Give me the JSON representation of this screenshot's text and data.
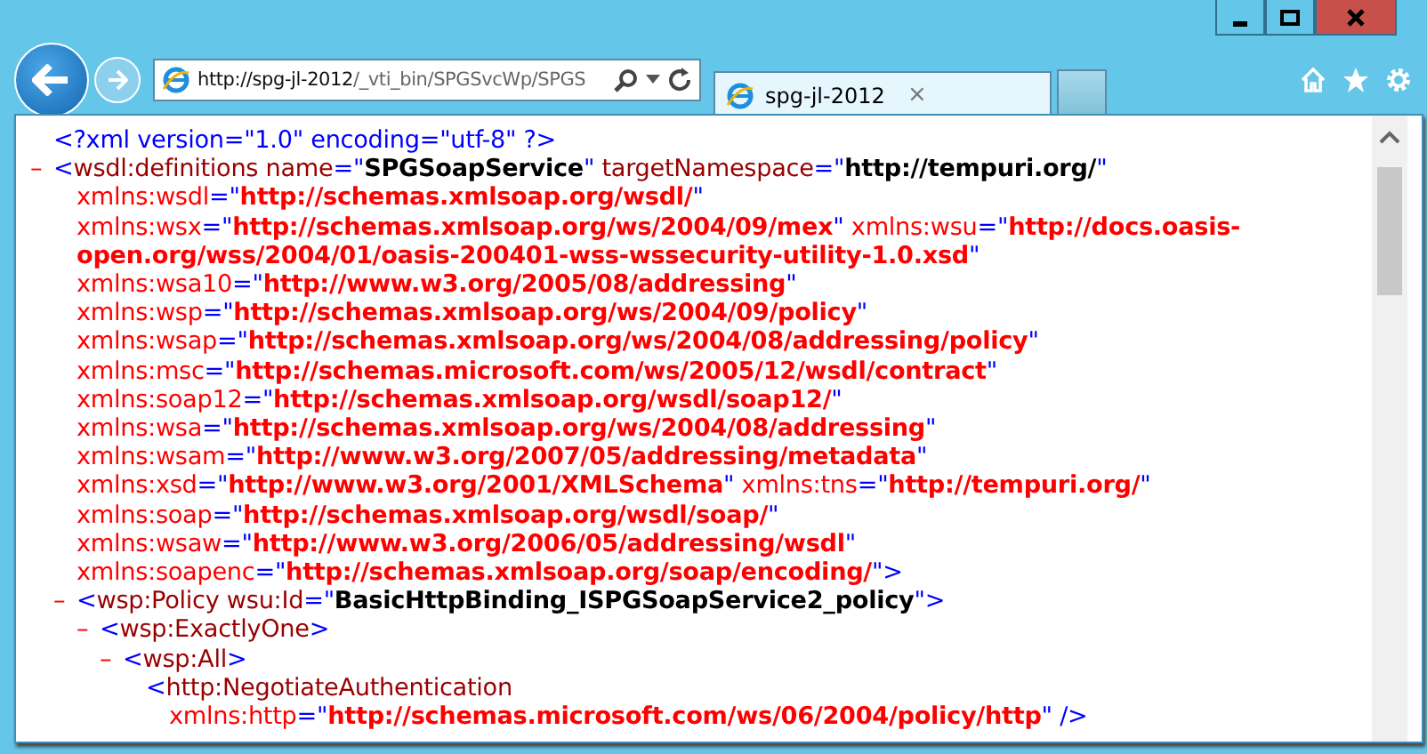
{
  "browser": {
    "address": {
      "url_host": "http://spg-jl-2012",
      "url_path": "/_vti_bin/SPGSvcWp/SPGS"
    },
    "tabs": [
      {
        "title": "spg-jl-2012",
        "selected": true,
        "close": "×"
      }
    ]
  },
  "document": {
    "declaration": [
      {
        "kind": "punct",
        "text": "<?xml version=\"1.0\" encoding=\"utf-8\" ?>"
      }
    ],
    "nodes": [
      {
        "toggle": "–",
        "expanded": true,
        "lines": [
          [
            {
              "kind": "punct",
              "text": "<"
            },
            {
              "kind": "name",
              "text": "wsdl:definitions name"
            },
            {
              "kind": "punct",
              "text": "=\""
            },
            {
              "kind": "value",
              "text": "SPGSoapService"
            },
            {
              "kind": "punct",
              "text": "\""
            },
            {
              "kind": "name",
              "text": " targetNamespace"
            },
            {
              "kind": "punct",
              "text": "=\""
            },
            {
              "kind": "value",
              "text": "http://tempuri.org/"
            },
            {
              "kind": "punct",
              "text": "\""
            }
          ],
          [
            {
              "kind": "nsattr",
              "text": "xmlns:wsdl"
            },
            {
              "kind": "punct",
              "text": "=\""
            },
            {
              "kind": "nsvalue",
              "text": "http://schemas.xmlsoap.org/wsdl/"
            },
            {
              "kind": "punct",
              "text": "\""
            }
          ],
          [
            {
              "kind": "nsattr",
              "text": "xmlns:wsx"
            },
            {
              "kind": "punct",
              "text": "=\""
            },
            {
              "kind": "nsvalue",
              "text": "http://schemas.xmlsoap.org/ws/2004/09/mex"
            },
            {
              "kind": "punct",
              "text": "\""
            },
            {
              "kind": "nsattr",
              "text": " xmlns:wsu"
            },
            {
              "kind": "punct",
              "text": "=\""
            },
            {
              "kind": "nsvalue",
              "text": "http://docs.oasis-"
            }
          ],
          [
            {
              "kind": "nsvalue",
              "text": "open.org/wss/2004/01/oasis-200401-wss-wssecurity-utility-1.0.xsd"
            },
            {
              "kind": "punct",
              "text": "\""
            }
          ],
          [
            {
              "kind": "nsattr",
              "text": "xmlns:wsa10"
            },
            {
              "kind": "punct",
              "text": "=\""
            },
            {
              "kind": "nsvalue",
              "text": "http://www.w3.org/2005/08/addressing"
            },
            {
              "kind": "punct",
              "text": "\""
            }
          ],
          [
            {
              "kind": "nsattr",
              "text": "xmlns:wsp"
            },
            {
              "kind": "punct",
              "text": "=\""
            },
            {
              "kind": "nsvalue",
              "text": "http://schemas.xmlsoap.org/ws/2004/09/policy"
            },
            {
              "kind": "punct",
              "text": "\""
            }
          ],
          [
            {
              "kind": "nsattr",
              "text": "xmlns:wsap"
            },
            {
              "kind": "punct",
              "text": "=\""
            },
            {
              "kind": "nsvalue",
              "text": "http://schemas.xmlsoap.org/ws/2004/08/addressing/policy"
            },
            {
              "kind": "punct",
              "text": "\""
            }
          ],
          [
            {
              "kind": "nsattr",
              "text": "xmlns:msc"
            },
            {
              "kind": "punct",
              "text": "=\""
            },
            {
              "kind": "nsvalue",
              "text": "http://schemas.microsoft.com/ws/2005/12/wsdl/contract"
            },
            {
              "kind": "punct",
              "text": "\""
            }
          ],
          [
            {
              "kind": "nsattr",
              "text": "xmlns:soap12"
            },
            {
              "kind": "punct",
              "text": "=\""
            },
            {
              "kind": "nsvalue",
              "text": "http://schemas.xmlsoap.org/wsdl/soap12/"
            },
            {
              "kind": "punct",
              "text": "\""
            }
          ],
          [
            {
              "kind": "nsattr",
              "text": "xmlns:wsa"
            },
            {
              "kind": "punct",
              "text": "=\""
            },
            {
              "kind": "nsvalue",
              "text": "http://schemas.xmlsoap.org/ws/2004/08/addressing"
            },
            {
              "kind": "punct",
              "text": "\""
            }
          ],
          [
            {
              "kind": "nsattr",
              "text": "xmlns:wsam"
            },
            {
              "kind": "punct",
              "text": "=\""
            },
            {
              "kind": "nsvalue",
              "text": "http://www.w3.org/2007/05/addressing/metadata"
            },
            {
              "kind": "punct",
              "text": "\""
            }
          ],
          [
            {
              "kind": "nsattr",
              "text": "xmlns:xsd"
            },
            {
              "kind": "punct",
              "text": "=\""
            },
            {
              "kind": "nsvalue",
              "text": "http://www.w3.org/2001/XMLSchema"
            },
            {
              "kind": "punct",
              "text": "\""
            },
            {
              "kind": "nsattr",
              "text": " xmlns:tns"
            },
            {
              "kind": "punct",
              "text": "=\""
            },
            {
              "kind": "nsvalue",
              "text": "http://tempuri.org/"
            },
            {
              "kind": "punct",
              "text": "\""
            }
          ],
          [
            {
              "kind": "nsattr",
              "text": "xmlns:soap"
            },
            {
              "kind": "punct",
              "text": "=\""
            },
            {
              "kind": "nsvalue",
              "text": "http://schemas.xmlsoap.org/wsdl/soap/"
            },
            {
              "kind": "punct",
              "text": "\""
            }
          ],
          [
            {
              "kind": "nsattr",
              "text": "xmlns:wsaw"
            },
            {
              "kind": "punct",
              "text": "=\""
            },
            {
              "kind": "nsvalue",
              "text": "http://www.w3.org/2006/05/addressing/wsdl"
            },
            {
              "kind": "punct",
              "text": "\""
            }
          ],
          [
            {
              "kind": "nsattr",
              "text": "xmlns:soapenc"
            },
            {
              "kind": "punct",
              "text": "=\""
            },
            {
              "kind": "nsvalue",
              "text": "http://schemas.xmlsoap.org/soap/encoding/"
            },
            {
              "kind": "punct",
              "text": "\">"
            }
          ]
        ],
        "children": [
          {
            "toggle": "–",
            "expanded": true,
            "lines": [
              [
                {
                  "kind": "punct",
                  "text": "<"
                },
                {
                  "kind": "name",
                  "text": "wsp:Policy wsu:Id"
                },
                {
                  "kind": "punct",
                  "text": "=\""
                },
                {
                  "kind": "value",
                  "text": "BasicHttpBinding_ISPGSoapService2_policy"
                },
                {
                  "kind": "punct",
                  "text": "\">"
                }
              ]
            ],
            "children": [
              {
                "toggle": "–",
                "expanded": true,
                "lines": [
                  [
                    {
                      "kind": "punct",
                      "text": "<"
                    },
                    {
                      "kind": "name",
                      "text": "wsp:ExactlyOne"
                    },
                    {
                      "kind": "punct",
                      "text": ">"
                    }
                  ]
                ],
                "children": [
                  {
                    "toggle": "–",
                    "expanded": true,
                    "lines": [
                      [
                        {
                          "kind": "punct",
                          "text": "<"
                        },
                        {
                          "kind": "name",
                          "text": "wsp:All"
                        },
                        {
                          "kind": "punct",
                          "text": ">"
                        }
                      ]
                    ],
                    "children": [
                      {
                        "lines": [
                          [
                            {
                              "kind": "punct",
                              "text": "<"
                            },
                            {
                              "kind": "name",
                              "text": "http:NegotiateAuthentication"
                            }
                          ],
                          [
                            {
                              "kind": "nsattr",
                              "text": "xmlns:http"
                            },
                            {
                              "kind": "punct",
                              "text": "=\""
                            },
                            {
                              "kind": "nsvalue",
                              "text": "http://schemas.microsoft.com/ws/06/2004/policy/http"
                            },
                            {
                              "kind": "punct",
                              "text": "\" />"
                            }
                          ]
                        ]
                      }
                    ]
                  }
                ]
              }
            ]
          }
        ]
      }
    ]
  }
}
